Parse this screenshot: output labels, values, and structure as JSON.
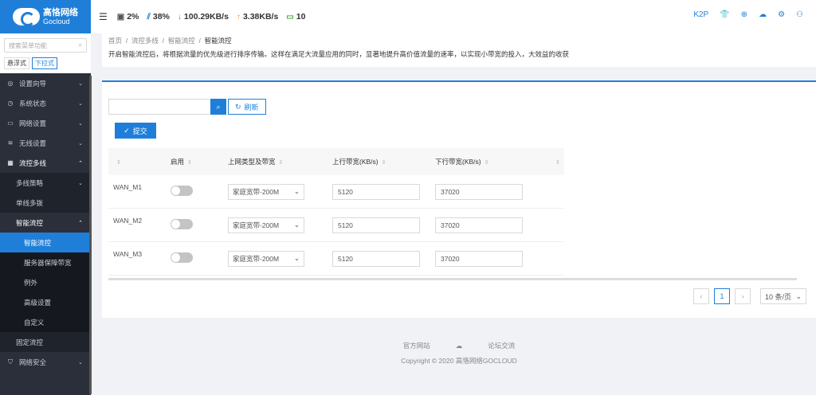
{
  "brand": {
    "name_cn": "高恪网络",
    "name_en": "Gocloud"
  },
  "header": {
    "cpu": "2%",
    "mem": "38%",
    "down": "100.29KB/s",
    "up": "3.38KB/s",
    "devices": "10",
    "model": "K2P"
  },
  "sidebar": {
    "search_placeholder": "搜索菜单功能",
    "mode_float": "悬浮式",
    "mode_dropdown": "下拉式",
    "items": [
      {
        "label": "设置向导",
        "icon": "compass-icon"
      },
      {
        "label": "系统状态",
        "icon": "dashboard-icon"
      },
      {
        "label": "网络设置",
        "icon": "monitor-icon"
      },
      {
        "label": "无线设置",
        "icon": "wifi-icon"
      },
      {
        "label": "流控多线",
        "icon": "flow-icon"
      }
    ],
    "sub": [
      "多线策略",
      "单线多拨",
      "智能流控"
    ],
    "sub2": [
      "智能流控",
      "服务器保障带宽",
      "例外",
      "高级设置",
      "自定义"
    ],
    "fixed": "固定流控",
    "security": "网络安全"
  },
  "breadcrumb": {
    "home": "首页",
    "level1": "流控多线",
    "level2": "智能流控",
    "level3": "智能流控",
    "description": "开启智能流控后，将根据流量的优先级进行排序传输。这样在满足大流量应用的同时，显著地提升高价值流量的速率，以实现小带宽的投入，大效益的收获"
  },
  "toolbar": {
    "refresh": "刷新",
    "submit": "提交"
  },
  "table": {
    "headers": [
      "",
      "启用",
      "上网类型及带宽",
      "上行带宽(KB/s)",
      "下行带宽(KB/s)",
      ""
    ],
    "rows": [
      {
        "name": "WAN_M1",
        "enabled": false,
        "type": "家庭宽带-200M",
        "up": "5120",
        "down": "37020"
      },
      {
        "name": "WAN_M2",
        "enabled": false,
        "type": "家庭宽带-200M",
        "up": "5120",
        "down": "37020"
      },
      {
        "name": "WAN_M3",
        "enabled": false,
        "type": "家庭宽带-200M",
        "up": "5120",
        "down": "37020"
      }
    ]
  },
  "pager": {
    "current": "1",
    "size": "10 条/页"
  },
  "footer": {
    "site": "官方网站",
    "forum": "论坛交流",
    "copyright": "Copyright © 2020 高恪网络GOCLOUD"
  }
}
